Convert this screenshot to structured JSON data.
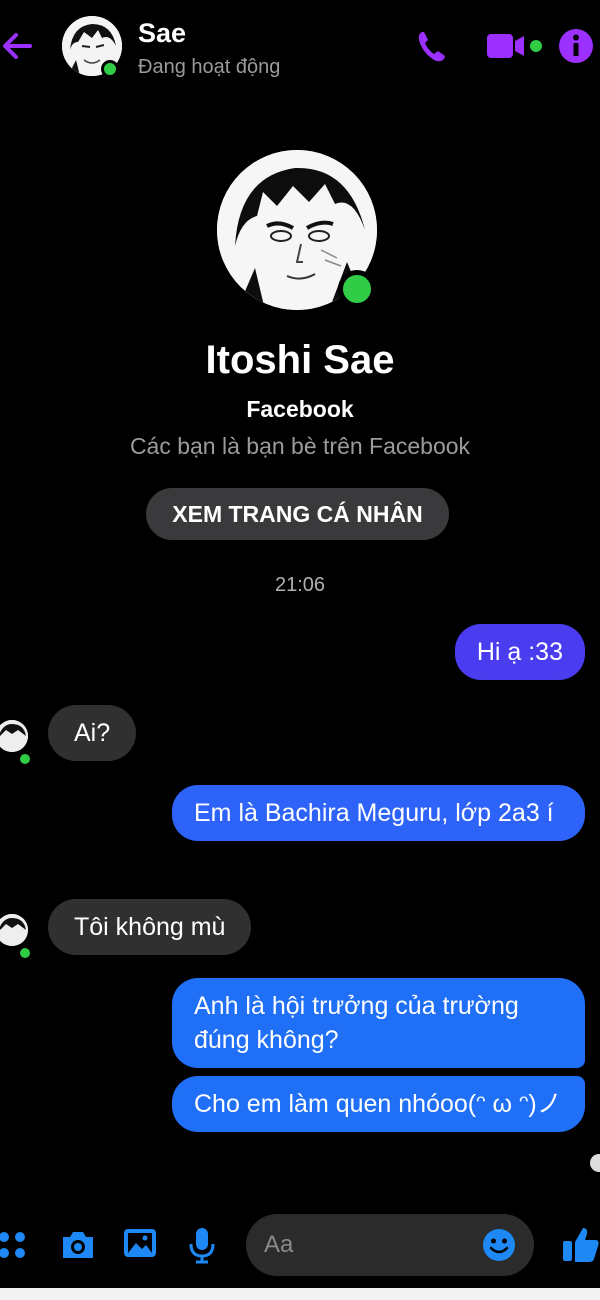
{
  "header": {
    "name": "Sae",
    "status": "Đang hoạt động",
    "icons": [
      "back-arrow-icon",
      "phone-icon",
      "video-call-icon",
      "info-icon"
    ]
  },
  "profile": {
    "name": "Itoshi Sae",
    "network": "Facebook",
    "relationship": "Các bạn là bạn bè trên Facebook",
    "view_profile_button": "XEM TRANG CÁ NHÂN"
  },
  "timestamp": "21:06",
  "messages": [
    {
      "from": "me",
      "text": "Hi ạ :33"
    },
    {
      "from": "them",
      "text": "Ai?"
    },
    {
      "from": "me",
      "text": "Em là Bachira Meguru, lớp 2a3 í"
    },
    {
      "from": "them",
      "text": "Tôi không mù"
    },
    {
      "from": "me",
      "text": "Anh là hội trưởng của trường đúng không?"
    },
    {
      "from": "me",
      "text": "Cho em làm quen nhóoo(ᵔ ω ᵔ)ノ"
    }
  ],
  "composer": {
    "placeholder": "Aa",
    "icons": [
      "menu-dots-icon",
      "camera-icon",
      "gallery-icon",
      "microphone-icon",
      "emoji-icon",
      "like-icon"
    ]
  },
  "colors": {
    "accent_purple": "#9b30ff",
    "active_green": "#31cc46",
    "bubble_outgoing_top": "#4a3df0",
    "bubble_outgoing_bottom": "#1f6ff7",
    "bubble_incoming": "#303030",
    "composer_icon_blue": "#1e88f5"
  }
}
